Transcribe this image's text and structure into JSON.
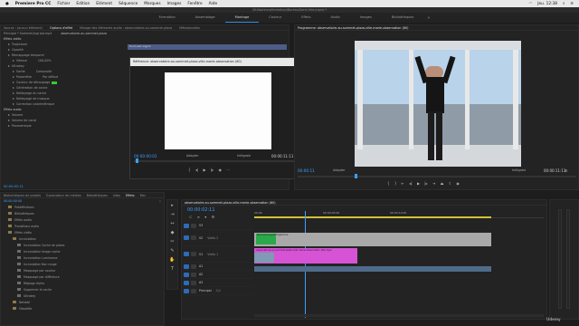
{
  "menubar": {
    "apple": "",
    "app": "Premiere Pro CC",
    "items": [
      "Fichier",
      "Edition",
      "Elément",
      "Séquence",
      "Marques",
      "Images",
      "Fenêtre",
      "Aide"
    ],
    "clock": "Jeu. 12:38"
  },
  "title_bar": "/Utilisateurs/formation/Bureau/Sans titre.prproj *",
  "workspaces": [
    {
      "label": "Formation"
    },
    {
      "label": "Assemblage"
    },
    {
      "label": "Montage",
      "active": true
    },
    {
      "label": "Couleur"
    },
    {
      "label": "Effets"
    },
    {
      "label": "Audio"
    },
    {
      "label": "Images"
    },
    {
      "label": "Bibliothèques"
    }
  ],
  "effect_controls": {
    "tabs": [
      "Source : (aucun élément)",
      "Options d'effet",
      "Mixage des éléments audio : observatoire-au-sommet-plaza",
      "Métadonnées"
    ],
    "master": "Principal * Sommet(Ingr)ed.mp4",
    "master_clip": "observatoire-au-sommet-plaza",
    "section_video": "Effets vidéo",
    "rows": [
      {
        "label": "Trajectoire",
        "indent": 1
      },
      {
        "label": "Opacité",
        "indent": 1
      },
      {
        "label": "Remappage temporel",
        "indent": 1
      },
      {
        "label": "Vitesse",
        "value": "100,00%",
        "indent": 2
      },
      {
        "label": "Ultrakey",
        "indent": 1
      },
      {
        "label": "Sortie",
        "value": "Composite",
        "indent": 2
      },
      {
        "label": "Paramètre",
        "value": "Par défaut",
        "indent": 2
      },
      {
        "label": "Couleur de découpage",
        "indent": 2,
        "swatch": true
      },
      {
        "label": "Génération de cache",
        "indent": 2
      },
      {
        "label": "Nettoyage du cache",
        "indent": 2
      },
      {
        "label": "Nettoyage de masque",
        "indent": 2
      },
      {
        "label": "Correction colorimétrique",
        "indent": 2
      }
    ],
    "section_audio": "Effets audio",
    "audio_rows": [
      {
        "label": "Volume"
      },
      {
        "label": "Volume de canal"
      },
      {
        "label": "Panoramique"
      }
    ],
    "clip_label": "fond-vert-ingrid"
  },
  "reference_modal": {
    "title": "Référence: observatoire-au-sommet-plaza-ville-marie-observation (60)",
    "timecode_left": "00:00:00:01",
    "fit": "Adapter",
    "quality": "Intégrale",
    "timecode_right": "00:00:11:11"
  },
  "program_monitor": {
    "title": "Programme: observatoire-au-sommet-plaza-ville-marie-observation (60)",
    "timecode_left": "00:00:11",
    "fit": "Adapter",
    "quality": "Intégrale",
    "timecode_right": "00:00:11:11"
  },
  "project_panel": {
    "tabs": [
      "Bibliothèques de projets",
      "Explorateur de médias",
      "Bibliothèques",
      "Infos",
      "Effets",
      "Mar"
    ],
    "header": "00:00:00:00",
    "items": [
      {
        "label": "Prédéfinitions",
        "type": "folder",
        "indent": 1
      },
      {
        "label": "Bibliothèques",
        "type": "folder",
        "indent": 1
      },
      {
        "label": "Effets audio",
        "type": "folder",
        "indent": 1
      },
      {
        "label": "Transitions audio",
        "type": "folder",
        "indent": 1
      },
      {
        "label": "Effets vidéo",
        "type": "folder",
        "indent": 1
      },
      {
        "label": "Incrustation",
        "type": "folder",
        "indent": 2
      },
      {
        "label": "Incrustation Cache de pistes",
        "type": "fx",
        "indent": 3
      },
      {
        "label": "Incrustation Image cache",
        "type": "fx",
        "indent": 3
      },
      {
        "label": "Incrustation Luminance",
        "type": "fx",
        "indent": 3
      },
      {
        "label": "Incrustation Non rouge",
        "type": "fx",
        "indent": 3
      },
      {
        "label": "Masquage par couleur",
        "type": "fx",
        "indent": 3
      },
      {
        "label": "Masquage par différence",
        "type": "fx",
        "indent": 3
      },
      {
        "label": "Réglage Alpha",
        "type": "fx",
        "indent": 3
      },
      {
        "label": "Supprimer le cache",
        "type": "fx",
        "indent": 3
      },
      {
        "label": "Ultrakey",
        "type": "fx",
        "indent": 3
      },
      {
        "label": "Netteté",
        "type": "folder",
        "indent": 2
      },
      {
        "label": "Obsolète",
        "type": "folder",
        "indent": 2
      }
    ]
  },
  "tools": [
    "▸",
    "⇥",
    "↔",
    "◆",
    "✂",
    "✎",
    "✋",
    "T"
  ],
  "timeline": {
    "tabs": [
      "observatoire-au-sommet-plaza-ville-marie-observation (60)"
    ],
    "timecode": "00:00:02:11",
    "ruler": [
      "00:00",
      "00:00:05:00",
      "00:00:10:00"
    ],
    "tracks": [
      {
        "label": "V3",
        "name": ""
      },
      {
        "label": "V2",
        "name": "Vidéo 2"
      },
      {
        "label": "V1",
        "name": "Vidéo 1"
      },
      {
        "label": "A1",
        "name": ""
      },
      {
        "label": "A2",
        "name": ""
      },
      {
        "label": "A3",
        "name": ""
      },
      {
        "label": "Principal",
        "name": "0,0"
      }
    ],
    "clips": [
      {
        "label": "fond-vert-ingrid-Trajectoire",
        "track": "V2",
        "color": "#a9a9a9"
      },
      {
        "label": "observatoire-au-sommet-plaza-ville-marie-observation (60).mp4",
        "track": "V1",
        "color": "#d653d6"
      },
      {
        "label": "",
        "track": "A1",
        "color": "#4f6b8a"
      }
    ]
  },
  "brand": "Udemy"
}
